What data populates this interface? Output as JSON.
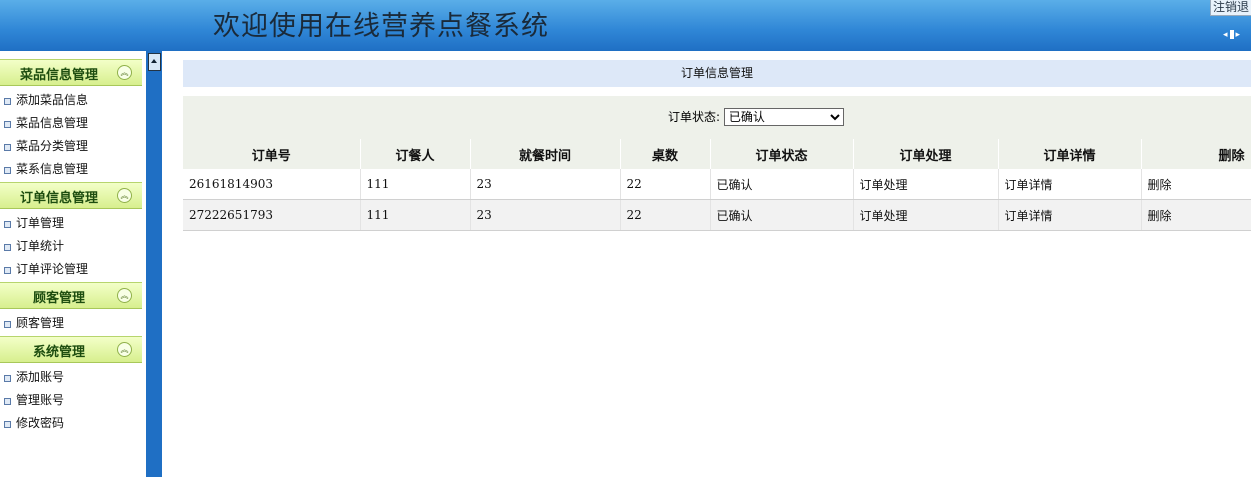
{
  "header": {
    "title": "欢迎使用在线营养点餐系统",
    "logout": "注销退"
  },
  "sidebar": {
    "sections": [
      {
        "title": "菜品信息管理",
        "items": [
          "添加菜品信息",
          "菜品信息管理",
          "菜品分类管理",
          "菜系信息管理"
        ]
      },
      {
        "title": "订单信息管理",
        "items": [
          "订单管理",
          "订单统计",
          "订单评论管理"
        ]
      },
      {
        "title": "顾客管理",
        "items": [
          "顾客管理"
        ]
      },
      {
        "title": "系统管理",
        "items": [
          "添加账号",
          "管理账号",
          "修改密码"
        ]
      }
    ]
  },
  "main": {
    "title": "订单信息管理",
    "filter_label": "订单状态:",
    "filter_value": "已确认",
    "columns": [
      "订单号",
      "订餐人",
      "就餐时间",
      "桌数",
      "订单状态",
      "订单处理",
      "订单详情",
      "删除"
    ],
    "rows": [
      [
        "26161814903",
        "111",
        "23",
        "22",
        "已确认",
        "订单处理",
        "订单详情",
        "删除"
      ],
      [
        "27222651793",
        "111",
        "23",
        "22",
        "已确认",
        "订单处理",
        "订单详情",
        "删除"
      ]
    ]
  },
  "colors": {
    "header_blue": "#2f86d6",
    "section_green": "#d7ef8e",
    "title_bar": "#dde8f8",
    "filter_bg": "#eef1ea"
  },
  "icons": [
    "collapse-chevron-icon",
    "list-bullet-icon",
    "sidebar-toggle-icon",
    "scroll-up-icon",
    "select-arrow-icon"
  ]
}
